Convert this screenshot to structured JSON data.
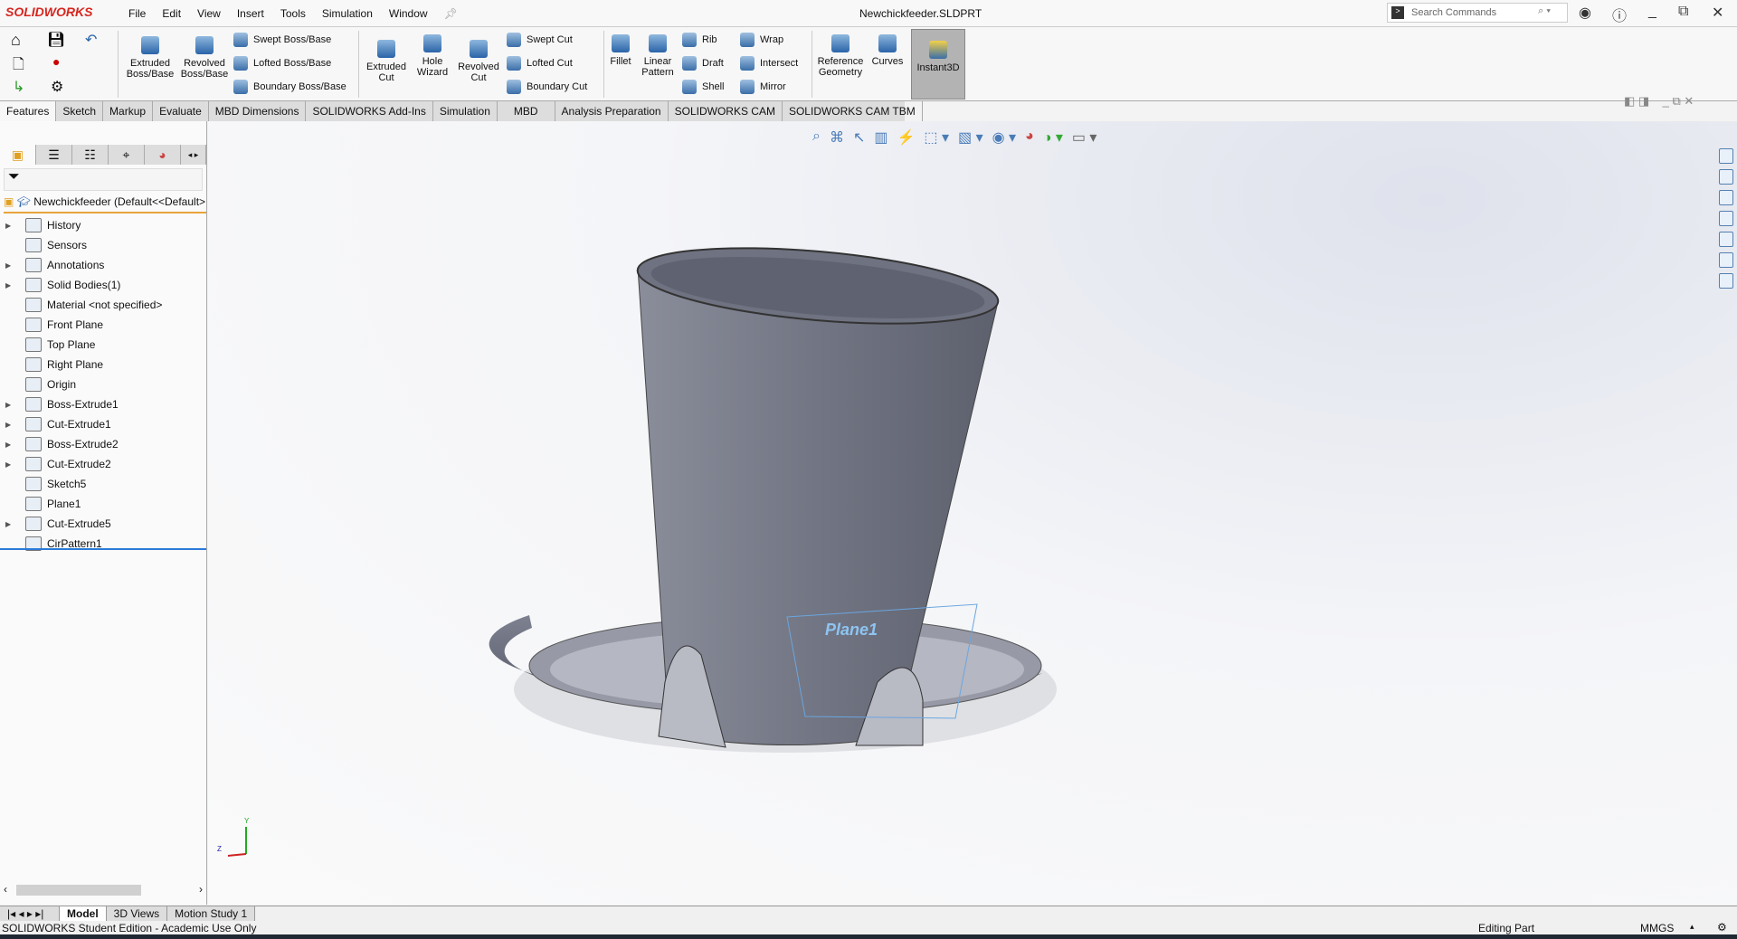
{
  "app": {
    "logo": "SOLIDWORKS",
    "document_title": "Newchickfeeder.SLDPRT"
  },
  "menu": [
    "File",
    "Edit",
    "View",
    "Insert",
    "Tools",
    "Simulation",
    "Window"
  ],
  "search": {
    "placeholder": "Search Commands"
  },
  "ribbon": {
    "extruded_boss": "Extruded Boss/Base",
    "revolved_boss": "Revolved Boss/Base",
    "swept_boss": "Swept Boss/Base",
    "lofted_boss": "Lofted Boss/Base",
    "boundary_boss": "Boundary Boss/Base",
    "extruded_cut": "Extruded Cut",
    "hole_wizard": "Hole Wizard",
    "revolved_cut": "Revolved Cut",
    "swept_cut": "Swept Cut",
    "lofted_cut": "Lofted Cut",
    "boundary_cut": "Boundary Cut",
    "fillet": "Fillet",
    "linear_pattern": "Linear Pattern",
    "rib": "Rib",
    "draft": "Draft",
    "shell": "Shell",
    "wrap": "Wrap",
    "intersect": "Intersect",
    "mirror": "Mirror",
    "reference_geometry": "Reference Geometry",
    "curves": "Curves",
    "instant3d": "Instant3D"
  },
  "tabs": [
    "Features",
    "Sketch",
    "Markup",
    "Evaluate",
    "MBD Dimensions",
    "SOLIDWORKS Add-Ins",
    "Simulation",
    "MBD",
    "Analysis Preparation",
    "SOLIDWORKS CAM",
    "SOLIDWORKS CAM TBM"
  ],
  "active_tab": "Features",
  "tree": {
    "root": "Newchickfeeder  (Default<<Default>",
    "items": [
      {
        "label": "History",
        "expandable": true
      },
      {
        "label": "Sensors",
        "expandable": false
      },
      {
        "label": "Annotations",
        "expandable": true
      },
      {
        "label": "Solid Bodies(1)",
        "expandable": true
      },
      {
        "label": "Material <not specified>",
        "expandable": false
      },
      {
        "label": "Front Plane",
        "expandable": false
      },
      {
        "label": "Top Plane",
        "expandable": false
      },
      {
        "label": "Right Plane",
        "expandable": false
      },
      {
        "label": "Origin",
        "expandable": false
      },
      {
        "label": "Boss-Extrude1",
        "expandable": true
      },
      {
        "label": "Cut-Extrude1",
        "expandable": true
      },
      {
        "label": "Boss-Extrude2",
        "expandable": true
      },
      {
        "label": "Cut-Extrude2",
        "expandable": true
      },
      {
        "label": "Sketch5",
        "expandable": false
      },
      {
        "label": "Plane1",
        "expandable": false
      },
      {
        "label": "Cut-Extrude5",
        "expandable": true
      },
      {
        "label": "CirPattern1",
        "expandable": false
      }
    ]
  },
  "viewport": {
    "plane_label": "Plane1",
    "triad": {
      "y": "Y",
      "z": "Z"
    },
    "model_color": "#6b6e7c"
  },
  "bottom_tabs": [
    "Model",
    "3D Views",
    "Motion Study 1"
  ],
  "status": {
    "left": "SOLIDWORKS Student Edition - Academic Use Only",
    "mode": "Editing Part",
    "units": "MMGS"
  }
}
